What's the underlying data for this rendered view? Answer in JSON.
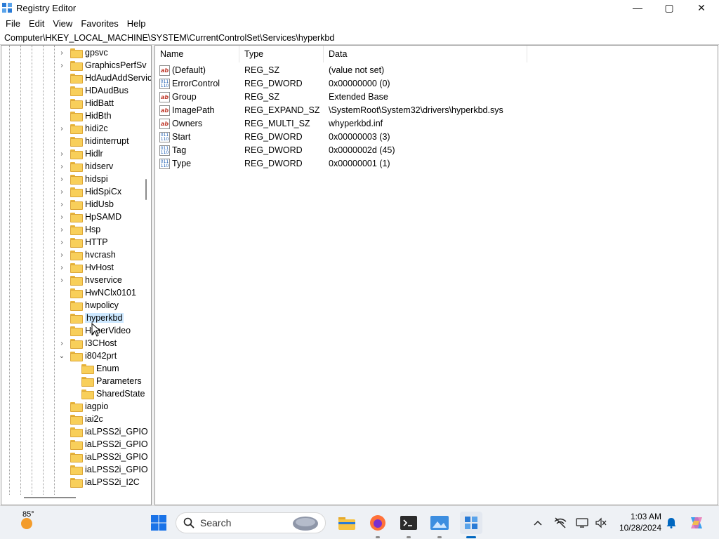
{
  "window": {
    "title": "Registry Editor",
    "controls": {
      "minimize": "—",
      "maximize": "▢",
      "close": "✕"
    }
  },
  "menu": [
    "File",
    "Edit",
    "View",
    "Favorites",
    "Help"
  ],
  "address": "Computer\\HKEY_LOCAL_MACHINE\\SYSTEM\\CurrentControlSet\\Services\\hyperkbd",
  "tree": {
    "items": [
      {
        "label": "gpsvc",
        "expander": "›"
      },
      {
        "label": "GraphicsPerfSv",
        "expander": "›"
      },
      {
        "label": "HdAudAddService",
        "expander": ""
      },
      {
        "label": "HDAudBus",
        "expander": ""
      },
      {
        "label": "HidBatt",
        "expander": ""
      },
      {
        "label": "HidBth",
        "expander": ""
      },
      {
        "label": "hidi2c",
        "expander": "›"
      },
      {
        "label": "hidinterrupt",
        "expander": ""
      },
      {
        "label": "Hidlr",
        "expander": "›"
      },
      {
        "label": "hidserv",
        "expander": "›"
      },
      {
        "label": "hidspi",
        "expander": "›"
      },
      {
        "label": "HidSpiCx",
        "expander": "›"
      },
      {
        "label": "HidUsb",
        "expander": "›"
      },
      {
        "label": "HpSAMD",
        "expander": "›"
      },
      {
        "label": "Hsp",
        "expander": "›"
      },
      {
        "label": "HTTP",
        "expander": "›"
      },
      {
        "label": "hvcrash",
        "expander": "›"
      },
      {
        "label": "HvHost",
        "expander": "›"
      },
      {
        "label": "hvservice",
        "expander": "›"
      },
      {
        "label": "HwNClx0101",
        "expander": ""
      },
      {
        "label": "hwpolicy",
        "expander": ""
      },
      {
        "label": "hyperkbd",
        "expander": "",
        "selected": true
      },
      {
        "label": "HyperVideo",
        "expander": ""
      },
      {
        "label": "I3CHost",
        "expander": "›"
      },
      {
        "label": "i8042prt",
        "expander": "⌄"
      },
      {
        "label": "Enum",
        "expander": "",
        "child": true
      },
      {
        "label": "Parameters",
        "expander": "",
        "child": true
      },
      {
        "label": "SharedState",
        "expander": "",
        "child": true
      },
      {
        "label": "iagpio",
        "expander": ""
      },
      {
        "label": "iai2c",
        "expander": ""
      },
      {
        "label": "iaLPSS2i_GPIO",
        "expander": ""
      },
      {
        "label": "iaLPSS2i_GPIO",
        "expander": ""
      },
      {
        "label": "iaLPSS2i_GPIO",
        "expander": ""
      },
      {
        "label": "iaLPSS2i_GPIO",
        "expander": ""
      },
      {
        "label": "iaLPSS2i_I2C",
        "expander": ""
      }
    ]
  },
  "values": {
    "headers": {
      "name": "Name",
      "type": "Type",
      "data": "Data"
    },
    "rows": [
      {
        "icon": "string-value-icon",
        "name": "(Default)",
        "type": "REG_SZ",
        "data": "(value not set)"
      },
      {
        "icon": "binary-value-icon",
        "name": "ErrorControl",
        "type": "REG_DWORD",
        "data": "0x00000000 (0)"
      },
      {
        "icon": "string-value-icon",
        "name": "Group",
        "type": "REG_SZ",
        "data": "Extended Base"
      },
      {
        "icon": "string-value-icon",
        "name": "ImagePath",
        "type": "REG_EXPAND_SZ",
        "data": "\\SystemRoot\\System32\\drivers\\hyperkbd.sys"
      },
      {
        "icon": "string-value-icon",
        "name": "Owners",
        "type": "REG_MULTI_SZ",
        "data": "whyperkbd.inf"
      },
      {
        "icon": "binary-value-icon",
        "name": "Start",
        "type": "REG_DWORD",
        "data": "0x00000003 (3)"
      },
      {
        "icon": "binary-value-icon",
        "name": "Tag",
        "type": "REG_DWORD",
        "data": "0x0000002d (45)"
      },
      {
        "icon": "binary-value-icon",
        "name": "Type",
        "type": "REG_DWORD",
        "data": "0x00000001 (1)"
      }
    ]
  },
  "taskbar": {
    "weather": "85°",
    "search_placeholder": "Search",
    "time": "1:03 AM",
    "date": "10/28/2024",
    "colors": {
      "start": "#1a73e8",
      "accent": "#0067c0"
    }
  }
}
